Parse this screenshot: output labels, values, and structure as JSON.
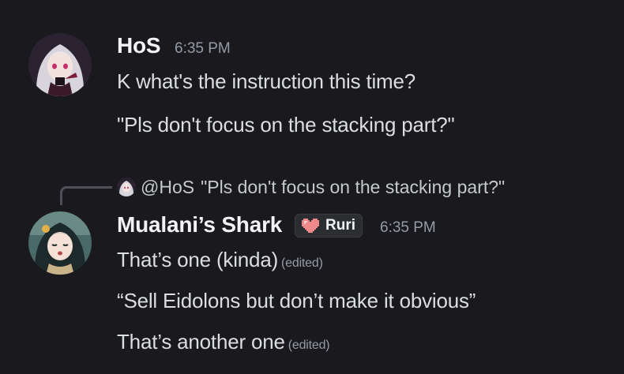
{
  "messages": [
    {
      "author": "HoS",
      "time": "6:35 PM",
      "avatar_icon": "anime-avatar-white-hair",
      "lines": [
        {
          "text": "K what's the instruction this time?",
          "edited": ""
        },
        {
          "text": "\"Pls don't focus on the stacking part?\"",
          "edited": ""
        }
      ]
    },
    {
      "reply": {
        "mention": "@HoS",
        "text": "\"Pls don't focus on the stacking part?\""
      },
      "author": "Mualani’s Shark",
      "tag": {
        "icon": "pixel-heart-icon",
        "label": "Ruri"
      },
      "time": "6:35 PM",
      "avatar_icon": "anime-avatar-dark-hair",
      "lines": [
        {
          "text": "That’s one (kinda)",
          "edited": "(edited)"
        },
        {
          "text": "“Sell Eidolons but don’t make it obvious”",
          "edited": ""
        },
        {
          "text": "That’s another one",
          "edited": "(edited)"
        }
      ]
    }
  ],
  "colors": {
    "background": "#1a1a1e",
    "username": "#f2f3f5",
    "text": "#dbdee1",
    "muted": "#949ba4",
    "heart": "#f08a8a"
  }
}
